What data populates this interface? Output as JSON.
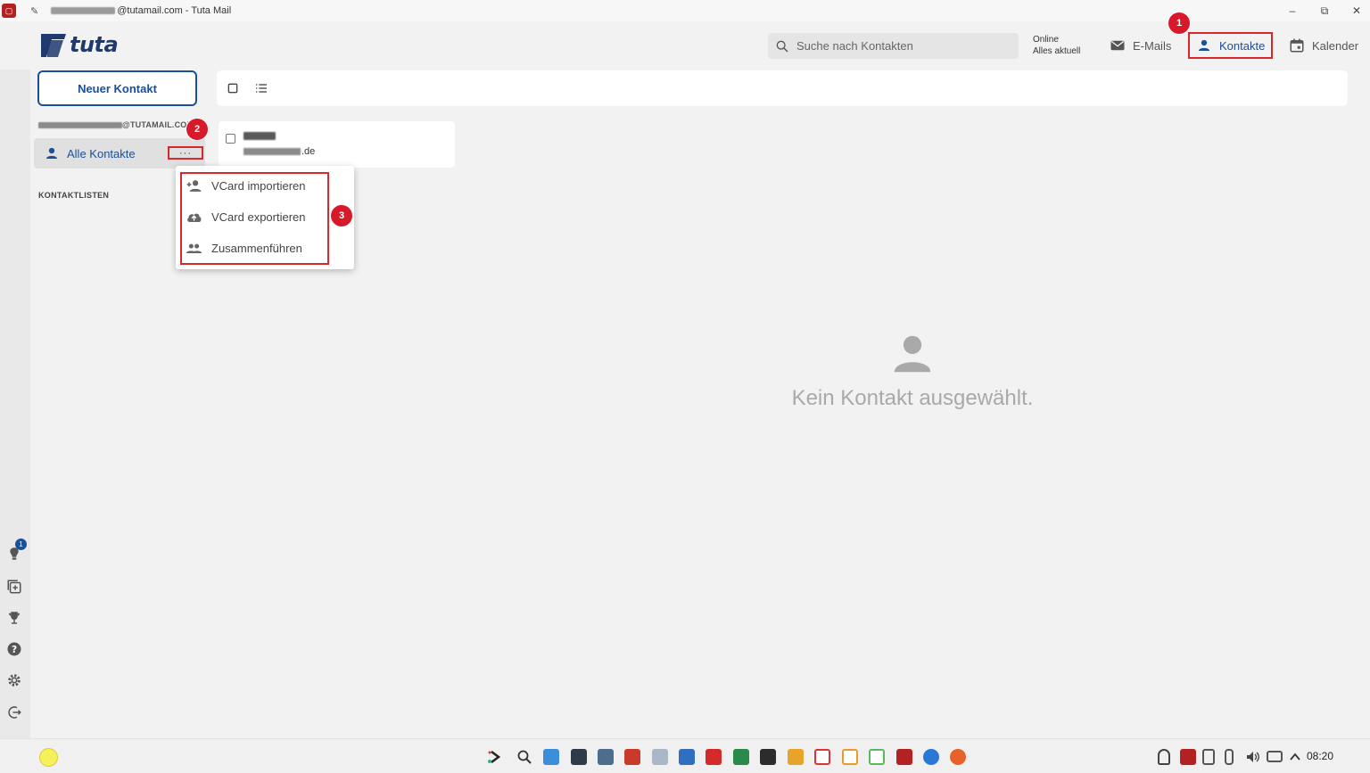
{
  "window": {
    "title_suffix": "@tutamail.com - Tuta Mail",
    "controls": [
      "–",
      "⧉",
      "✕"
    ]
  },
  "header": {
    "logo_text": "tuta",
    "search_placeholder": "Suche nach Kontakten",
    "status_line1": "Online",
    "status_line2": "Alles aktuell",
    "nav": {
      "emails": "E-Mails",
      "contacts": "Kontakte",
      "calendar": "Kalender"
    }
  },
  "sidebar": {
    "new_contact_label": "Neuer Kontakt",
    "account_suffix": "@TUTAMAIL.COM",
    "all_contacts_label": "Alle Kontakte",
    "more_label": "···",
    "contact_lists_heading": "KONTAKTLISTEN",
    "rail_badge": "1"
  },
  "contact_list": {
    "items": [
      {
        "email_suffix": ".de"
      }
    ]
  },
  "context_menu": {
    "items": [
      {
        "label": "VCard importieren",
        "icon": "person-add-icon"
      },
      {
        "label": "VCard exportieren",
        "icon": "cloud-upload-icon"
      },
      {
        "label": "Zusammenführen",
        "icon": "people-icon"
      }
    ]
  },
  "detail": {
    "empty_message": "Kein Kontakt ausgewählt."
  },
  "annotations": {
    "step1": "1",
    "step2": "2",
    "step3": "3"
  },
  "taskbar": {
    "clock": "08:20"
  },
  "colors": {
    "accent": "#1a4f9c",
    "highlight": "#d7292c",
    "badge": "#d7192a"
  }
}
